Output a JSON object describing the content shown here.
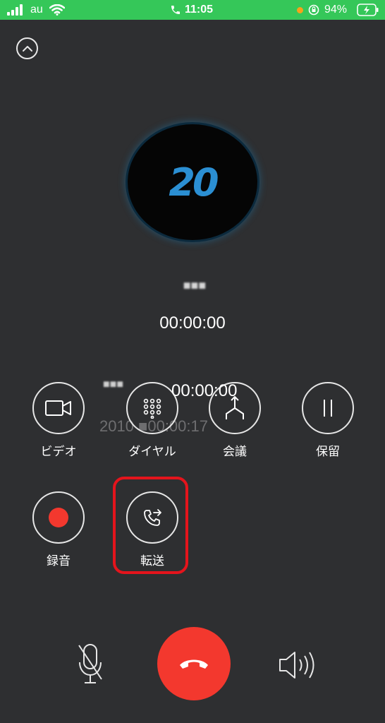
{
  "status_bar": {
    "carrier": "au",
    "time": "11:05",
    "battery": "94%",
    "bar_color": "#35c759"
  },
  "call": {
    "avatar_text": "20",
    "caller_name": "■■■",
    "timer": "00:00:00",
    "ghost_name": "■■■",
    "ghost_timer": "00:00:00",
    "ghost_sub": "2010 ■00:00:17"
  },
  "controls": {
    "video": "ビデオ",
    "dial": "ダイヤル",
    "conference": "会議",
    "hold": "保留",
    "record": "録音",
    "transfer": "転送"
  },
  "colors": {
    "background": "#2e2f31",
    "end_call": "#f3382e",
    "record_dot": "#f3382e",
    "highlight": "#e4141c"
  }
}
